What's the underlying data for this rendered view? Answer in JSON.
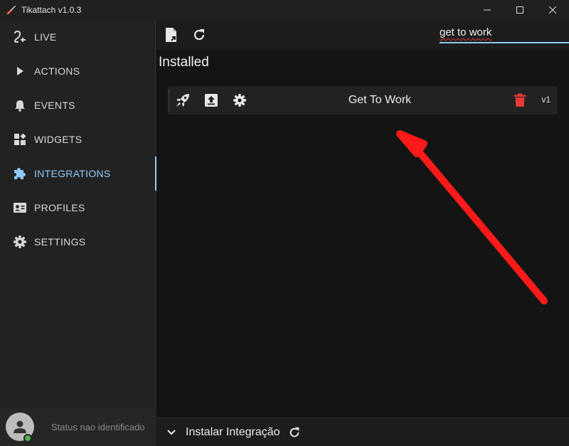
{
  "window": {
    "title": "Tikattach v1.0.3"
  },
  "sidebar": {
    "items": [
      {
        "label": "LIVE",
        "icon": "power-plug-icon"
      },
      {
        "label": "ACTIONS",
        "icon": "play-icon"
      },
      {
        "label": "EVENTS",
        "icon": "bell-icon"
      },
      {
        "label": "WIDGETS",
        "icon": "widgets-icon"
      },
      {
        "label": "INTEGRATIONS",
        "icon": "puzzle-icon",
        "active": true
      },
      {
        "label": "PROFILES",
        "icon": "id-card-icon"
      },
      {
        "label": "SETTINGS",
        "icon": "gear-icon"
      }
    ],
    "user": {
      "status_text": "Status nao identificado"
    }
  },
  "toolbar": {
    "search_value": "get to work"
  },
  "main": {
    "section_title": "Installed",
    "integrations": [
      {
        "name": "Get To Work",
        "version": "v1"
      }
    ]
  },
  "footer": {
    "install_label": "Instalar Integração"
  },
  "colors": {
    "accent": "#90caf9",
    "delete": "#e53935",
    "annotation_arrow": "#ff1a1a",
    "online": "#4caf50"
  }
}
